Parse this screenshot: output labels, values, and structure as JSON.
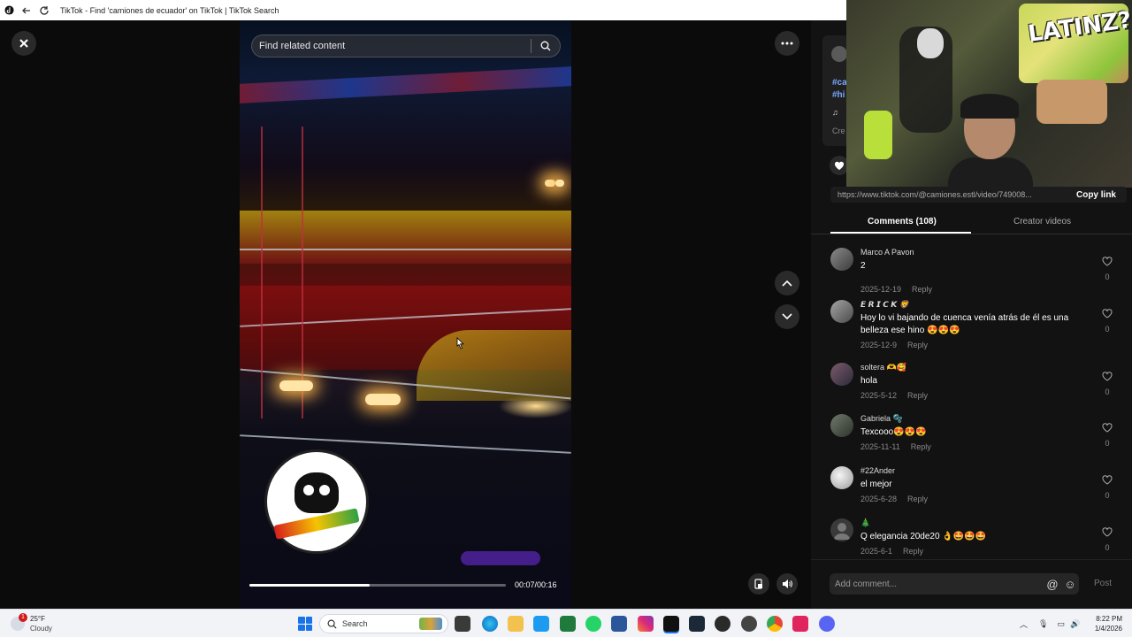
{
  "titlebar": {
    "title": "TikTok - Find 'camiones de ecuador' on TikTok | TikTok Search"
  },
  "player": {
    "search_placeholder": "Find related content",
    "time": "00:07/00:16",
    "progress": 0.47
  },
  "side_info": {
    "fragment_tag_1": "#ca",
    "fragment_tag_2": "#hi",
    "fragment_music": "♫",
    "fragment_gray": "Cre"
  },
  "webcam": {
    "graffiti_text": "LATINZ?!"
  },
  "share": {
    "url": "https://www.tiktok.com/@camiones.estl/video/749008...",
    "copy_label": "Copy link"
  },
  "tabs": {
    "comments_label": "Comments (108)",
    "creator_label": "Creator videos"
  },
  "comments": [
    {
      "author": "Marco A Pavon",
      "text": "2",
      "date": "2025-12-19",
      "reply": "Reply",
      "likes": "0"
    },
    {
      "author": "𝙀 𝙍 𝙄 𝘾 𝙆 🦁",
      "text": "Hoy lo vi bajando de cuenca venía atrás de él es una belleza ese hino 😍😍😍",
      "date": "2025-12-9",
      "reply": "Reply",
      "likes": "0"
    },
    {
      "author": "soltera 🫶🥰",
      "text": "hola",
      "date": "2025-5-12",
      "reply": "Reply",
      "likes": "0"
    },
    {
      "author": "Gabriela 🫧",
      "text": "Texcooo😍😍😍",
      "date": "2025-11-11",
      "reply": "Reply",
      "likes": "0"
    },
    {
      "author": "#22Ander",
      "text": "el mejor",
      "date": "2025-6-28",
      "reply": "Reply",
      "likes": "0"
    },
    {
      "author": "🎄",
      "text": "Q elegancia 20de20 👌🤩🤩🤩",
      "date": "2025-6-1",
      "reply": "Reply",
      "likes": "0"
    }
  ],
  "comment_bar": {
    "placeholder": "Add comment...",
    "post_label": "Post"
  },
  "taskbar": {
    "weather_temp": "25°F",
    "weather_desc": "Cloudy",
    "notification_count": "1",
    "search_label": "Search",
    "time": "8:22 PM",
    "date": "1/4/2026"
  },
  "colors": {
    "panel_bg": "#121212",
    "accent_link": "#7aa7ff",
    "taskbar_bg": "#f1f3f7"
  }
}
